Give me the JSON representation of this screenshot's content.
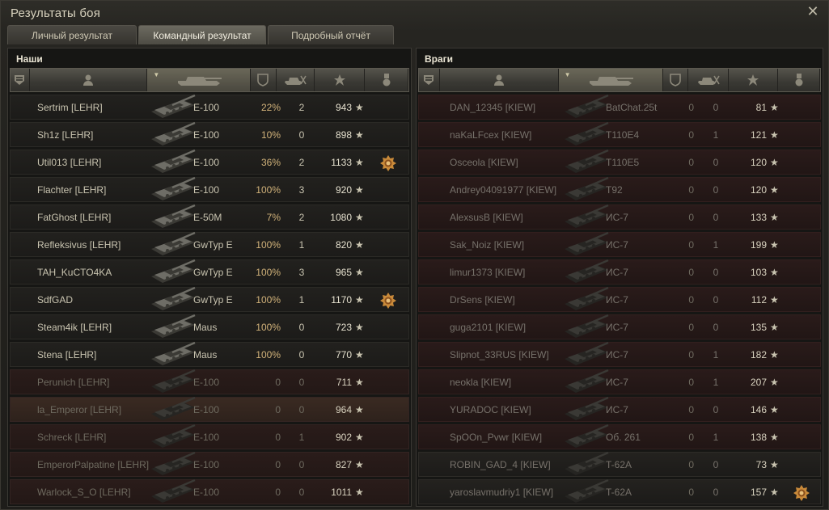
{
  "window": {
    "title": "Результаты боя"
  },
  "tabs": [
    {
      "label": "Личный результат",
      "active": false
    },
    {
      "label": "Командный результат",
      "active": true
    },
    {
      "label": "Подробный отчёт",
      "active": false
    }
  ],
  "header_icons": [
    "rank-icon",
    "player-icon",
    "tank-icon",
    "damage-shield-icon",
    "kills-icon",
    "xp-star-icon",
    "medal-icon"
  ],
  "allies": {
    "title": "Наши",
    "rows": [
      {
        "name": "Sertrim [LEHR]",
        "tank": "E-100",
        "pct": "22%",
        "kills": "2",
        "xp": "943",
        "alive": true,
        "medal": false
      },
      {
        "name": "Sh1z [LEHR]",
        "tank": "E-100",
        "pct": "10%",
        "kills": "0",
        "xp": "898",
        "alive": true,
        "medal": false
      },
      {
        "name": "Util013 [LEHR]",
        "tank": "E-100",
        "pct": "36%",
        "kills": "2",
        "xp": "1133",
        "alive": true,
        "medal": true
      },
      {
        "name": "Flachter [LEHR]",
        "tank": "E-100",
        "pct": "100%",
        "kills": "3",
        "xp": "920",
        "alive": true,
        "medal": false
      },
      {
        "name": "FatGhost [LEHR]",
        "tank": "E-50M",
        "pct": "7%",
        "kills": "2",
        "xp": "1080",
        "alive": true,
        "medal": false
      },
      {
        "name": "Refleksivus [LEHR]",
        "tank": "GwTyp E",
        "pct": "100%",
        "kills": "1",
        "xp": "820",
        "alive": true,
        "medal": false
      },
      {
        "name": "TAH_KuCTO4KA",
        "tank": "GwTyp E",
        "pct": "100%",
        "kills": "3",
        "xp": "965",
        "alive": true,
        "medal": false
      },
      {
        "name": "SdfGAD",
        "tank": "GwTyp E",
        "pct": "100%",
        "kills": "1",
        "xp": "1170",
        "alive": true,
        "medal": true
      },
      {
        "name": "Steam4ik [LEHR]",
        "tank": "Maus",
        "pct": "100%",
        "kills": "0",
        "xp": "723",
        "alive": true,
        "medal": false
      },
      {
        "name": "Stena [LEHR]",
        "tank": "Maus",
        "pct": "100%",
        "kills": "0",
        "xp": "770",
        "alive": true,
        "medal": false
      },
      {
        "name": "Perunich [LEHR]",
        "tank": "E-100",
        "pct": "0",
        "kills": "0",
        "xp": "711",
        "alive": false,
        "medal": false
      },
      {
        "name": "la_Emperor [LEHR]",
        "tank": "E-100",
        "pct": "0",
        "kills": "0",
        "xp": "964",
        "alive": false,
        "medal": false,
        "self": true
      },
      {
        "name": "Schreck [LEHR]",
        "tank": "E-100",
        "pct": "0",
        "kills": "1",
        "xp": "902",
        "alive": false,
        "medal": false
      },
      {
        "name": "EmperorPalpatine [LEHR]",
        "tank": "E-100",
        "pct": "0",
        "kills": "0",
        "xp": "827",
        "alive": false,
        "medal": false
      },
      {
        "name": "Warlock_S_O [LEHR]",
        "tank": "E-100",
        "pct": "0",
        "kills": "0",
        "xp": "1011",
        "alive": false,
        "medal": false
      }
    ]
  },
  "enemies": {
    "title": "Враги",
    "rows": [
      {
        "name": "DAN_12345 [KIEW]",
        "tank": "BatChat.25t",
        "pct": "0",
        "kills": "0",
        "xp": "81",
        "alive": false,
        "medal": false
      },
      {
        "name": "naKaLFcex [KIEW]",
        "tank": "T110E4",
        "pct": "0",
        "kills": "1",
        "xp": "121",
        "alive": false,
        "medal": false
      },
      {
        "name": "Osceola [KIEW]",
        "tank": "T110E5",
        "pct": "0",
        "kills": "0",
        "xp": "120",
        "alive": false,
        "medal": false
      },
      {
        "name": "Andrey04091977 [KIEW]",
        "tank": "T92",
        "pct": "0",
        "kills": "0",
        "xp": "120",
        "alive": false,
        "medal": false
      },
      {
        "name": "AlexsusB [KIEW]",
        "tank": "ИС-7",
        "pct": "0",
        "kills": "0",
        "xp": "133",
        "alive": false,
        "medal": false
      },
      {
        "name": "Sak_Noiz [KIEW]",
        "tank": "ИС-7",
        "pct": "0",
        "kills": "1",
        "xp": "199",
        "alive": false,
        "medal": false
      },
      {
        "name": "limur1373 [KIEW]",
        "tank": "ИС-7",
        "pct": "0",
        "kills": "0",
        "xp": "103",
        "alive": false,
        "medal": false
      },
      {
        "name": "DrSens [KIEW]",
        "tank": "ИС-7",
        "pct": "0",
        "kills": "0",
        "xp": "112",
        "alive": false,
        "medal": false
      },
      {
        "name": "guga2101 [KIEW]",
        "tank": "ИС-7",
        "pct": "0",
        "kills": "0",
        "xp": "135",
        "alive": false,
        "medal": false
      },
      {
        "name": "Slipnot_33RUS [KIEW]",
        "tank": "ИС-7",
        "pct": "0",
        "kills": "1",
        "xp": "182",
        "alive": false,
        "medal": false
      },
      {
        "name": "neokla [KIEW]",
        "tank": "ИС-7",
        "pct": "0",
        "kills": "1",
        "xp": "207",
        "alive": false,
        "medal": false
      },
      {
        "name": "YURADOC [KIEW]",
        "tank": "ИС-7",
        "pct": "0",
        "kills": "0",
        "xp": "146",
        "alive": false,
        "medal": false
      },
      {
        "name": "SpOOn_Pvwr [KIEW]",
        "tank": "Об. 261",
        "pct": "0",
        "kills": "1",
        "xp": "138",
        "alive": false,
        "medal": false
      },
      {
        "name": "ROBIN_GAD_4 [KIEW]",
        "tank": "T-62A",
        "pct": "0",
        "kills": "0",
        "xp": "73",
        "alive": true,
        "medal": false
      },
      {
        "name": "yaroslavmudriy1 [KIEW]",
        "tank": "T-62A",
        "pct": "0",
        "kills": "0",
        "xp": "157",
        "alive": true,
        "medal": true
      }
    ]
  },
  "colors": {
    "accent": "#d1b27a",
    "dead_row": "#2a1c1a",
    "alive_row": "#22211e"
  },
  "star_glyph": "★"
}
